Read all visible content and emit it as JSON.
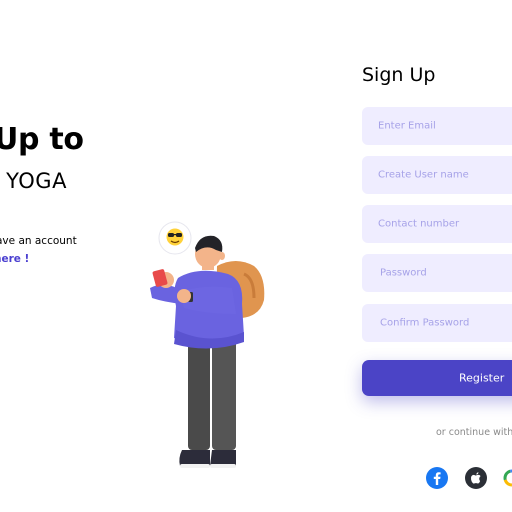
{
  "left": {
    "heading_line1": "Up to",
    "heading_line2": "YOGA",
    "have_account": "ave an account",
    "login_link": "here !"
  },
  "form": {
    "title": "Sign Up",
    "fields": [
      {
        "placeholder": "Enter Email"
      },
      {
        "placeholder": "Create User name"
      },
      {
        "placeholder": "Contact number"
      },
      {
        "placeholder": "Password"
      },
      {
        "placeholder": "Confirm Password"
      }
    ],
    "register_label": "Register",
    "continue_with": "or continue with"
  },
  "social": [
    "facebook-icon",
    "apple-icon",
    "google-icon"
  ],
  "colors": {
    "accent": "#4b44c6",
    "field_bg": "#efedff",
    "placeholder": "#a6a2e8",
    "link": "#4a3fd0"
  }
}
